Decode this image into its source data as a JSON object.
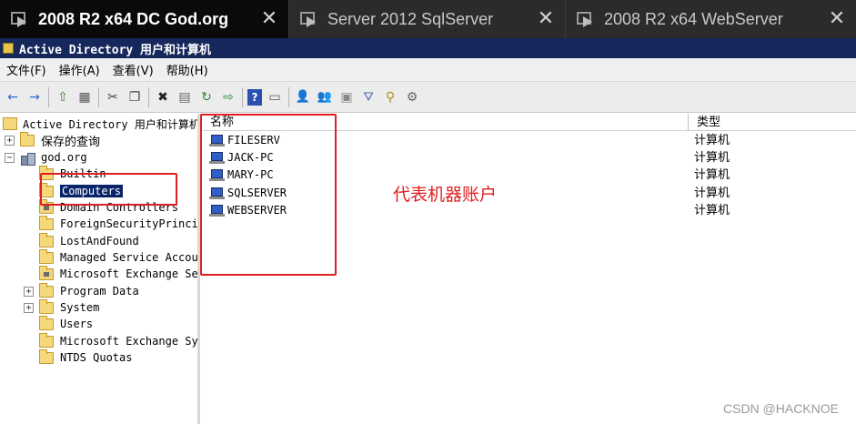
{
  "tabs": [
    {
      "title": "2008 R2 x64 DC God.org",
      "active": true
    },
    {
      "title": "Server 2012 SqlServer",
      "active": false
    },
    {
      "title": "2008 R2 x64 WebServer",
      "active": false
    }
  ],
  "tab_close_glyph": "✕",
  "window": {
    "title": "Active Directory 用户和计算机"
  },
  "menu": [
    "文件(F)",
    "操作(A)",
    "查看(V)",
    "帮助(H)"
  ],
  "toolbar": {
    "back": "←",
    "forward": "→",
    "up": "⇧",
    "properties": "▦",
    "cut": "✂",
    "copy": "❐",
    "delete": "✖",
    "props2": "▤",
    "refresh": "↻",
    "export": "⇨",
    "help": "?",
    "view": "▭",
    "user": "👤",
    "group": "👥",
    "ou": "▣",
    "filter": "⛛",
    "find": "⚲",
    "delegate": "⚙"
  },
  "tree": {
    "root": "Active Directory 用户和计算机",
    "saved_queries": "保存的查询",
    "domain": "god.org",
    "children": [
      "Builtin",
      "Computers",
      "Domain Controllers",
      "ForeignSecurityPrincip",
      "LostAndFound",
      "Managed Service Accour",
      "Microsoft Exchange Sec",
      "Program Data",
      "System",
      "Users",
      "Microsoft Exchange Sys",
      "NTDS Quotas"
    ],
    "expand_plus": "+",
    "expand_minus": "−"
  },
  "list": {
    "columns": {
      "name": "名称",
      "type": "类型"
    },
    "rows": [
      {
        "name": "FILESERV",
        "type": "计算机"
      },
      {
        "name": "JACK-PC",
        "type": "计算机"
      },
      {
        "name": "MARY-PC",
        "type": "计算机"
      },
      {
        "name": "SQLSERVER",
        "type": "计算机"
      },
      {
        "name": "WEBSERVER",
        "type": "计算机"
      }
    ]
  },
  "annotation": {
    "text": "代表机器账户",
    "color": "#e02020"
  },
  "watermark": "CSDN @HACKNOE"
}
